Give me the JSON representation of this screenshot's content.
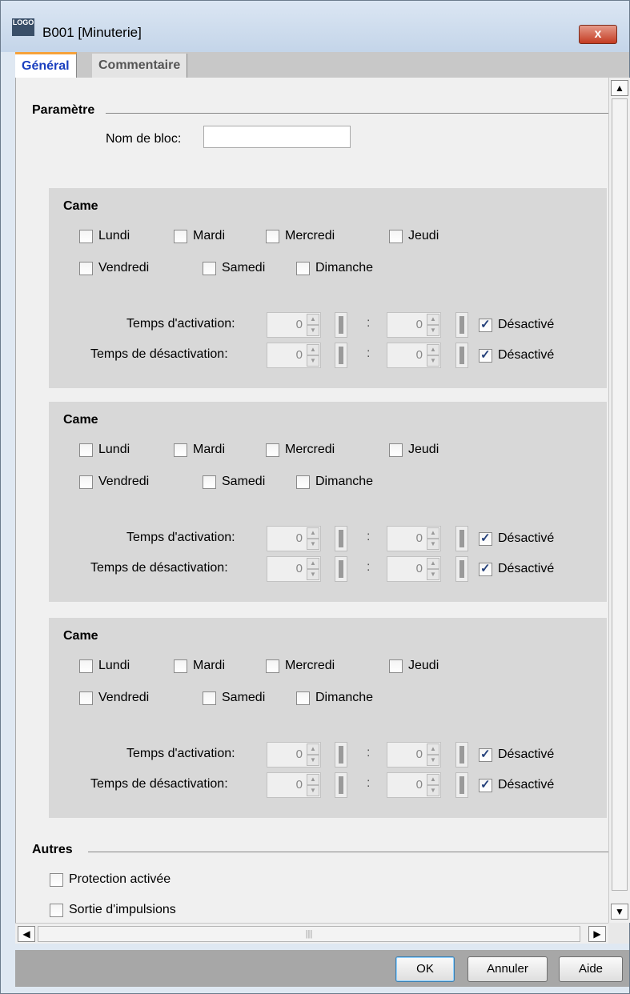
{
  "window": {
    "title": "B001 [Minuterie]",
    "icon": "logo-icon",
    "icon_text": "LOGO",
    "close_label": "x"
  },
  "tabs": [
    {
      "label": "Général",
      "active": true
    },
    {
      "label": "Commentaire",
      "active": false
    }
  ],
  "parametre": {
    "title": "Paramètre",
    "block_name_label": "Nom de bloc:",
    "block_name_value": ""
  },
  "cams": [
    {
      "title": "Came",
      "days": [
        {
          "label": "Lundi",
          "checked": false
        },
        {
          "label": "Mardi",
          "checked": false
        },
        {
          "label": "Mercredi",
          "checked": false
        },
        {
          "label": "Jeudi",
          "checked": false
        },
        {
          "label": "Vendredi",
          "checked": false
        },
        {
          "label": "Samedi",
          "checked": false
        },
        {
          "label": "Dimanche",
          "checked": false
        }
      ],
      "on_label": "Temps d'activation:",
      "off_label": "Temps de désactivation:",
      "on_hours": "0",
      "on_minutes": "0",
      "off_hours": "0",
      "off_minutes": "0",
      "separator": ":",
      "on_disabled_label": "Désactivé",
      "on_disabled": true,
      "off_disabled_label": "Désactivé",
      "off_disabled": true
    },
    {
      "title": "Came",
      "days": [
        {
          "label": "Lundi",
          "checked": false
        },
        {
          "label": "Mardi",
          "checked": false
        },
        {
          "label": "Mercredi",
          "checked": false
        },
        {
          "label": "Jeudi",
          "checked": false
        },
        {
          "label": "Vendredi",
          "checked": false
        },
        {
          "label": "Samedi",
          "checked": false
        },
        {
          "label": "Dimanche",
          "checked": false
        }
      ],
      "on_label": "Temps d'activation:",
      "off_label": "Temps de désactivation:",
      "on_hours": "0",
      "on_minutes": "0",
      "off_hours": "0",
      "off_minutes": "0",
      "separator": ":",
      "on_disabled_label": "Désactivé",
      "on_disabled": true,
      "off_disabled_label": "Désactivé",
      "off_disabled": true
    },
    {
      "title": "Came",
      "days": [
        {
          "label": "Lundi",
          "checked": false
        },
        {
          "label": "Mardi",
          "checked": false
        },
        {
          "label": "Mercredi",
          "checked": false
        },
        {
          "label": "Jeudi",
          "checked": false
        },
        {
          "label": "Vendredi",
          "checked": false
        },
        {
          "label": "Samedi",
          "checked": false
        },
        {
          "label": "Dimanche",
          "checked": false
        }
      ],
      "on_label": "Temps d'activation:",
      "off_label": "Temps de désactivation:",
      "on_hours": "0",
      "on_minutes": "0",
      "off_hours": "0",
      "off_minutes": "0",
      "separator": ":",
      "on_disabled_label": "Désactivé",
      "on_disabled": true,
      "off_disabled_label": "Désactivé",
      "off_disabled": true
    }
  ],
  "autres": {
    "title": "Autres",
    "protection_label": "Protection activée",
    "protection_checked": false,
    "pulse_label": "Sortie d'impulsions",
    "pulse_checked": false
  },
  "scrollbars": {
    "up_icon": "chevron-up-icon",
    "down_icon": "chevron-down-icon",
    "left_icon": "chevron-left-icon",
    "right_icon": "chevron-right-icon"
  },
  "footer": {
    "ok_label": "OK",
    "cancel_label": "Annuler",
    "help_label": "Aide"
  }
}
